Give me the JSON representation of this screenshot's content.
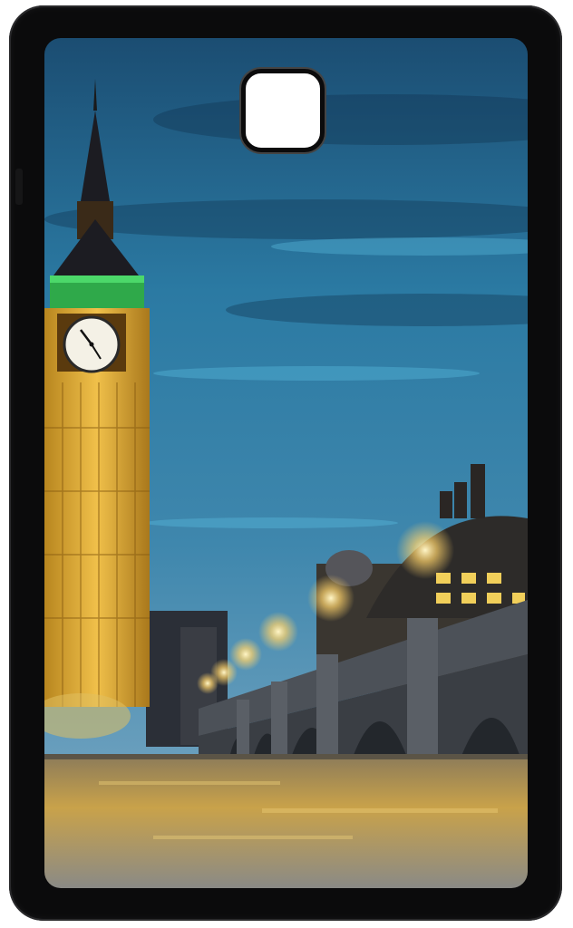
{
  "product": {
    "type": "tablet-back-case",
    "case_color": "#0b0b0c",
    "print_subject": "night-city-skyline-with-clock-tower-and-bridge"
  },
  "colors": {
    "sky_top": "#1a4a6e",
    "sky_mid": "#2a78a0",
    "sky_bottom": "#4c8cb0",
    "tower_gold": "#d9a233",
    "tower_green": "#3fbf5a",
    "river_gold": "#c9a24a",
    "bridge_stone": "#4a4f55"
  }
}
